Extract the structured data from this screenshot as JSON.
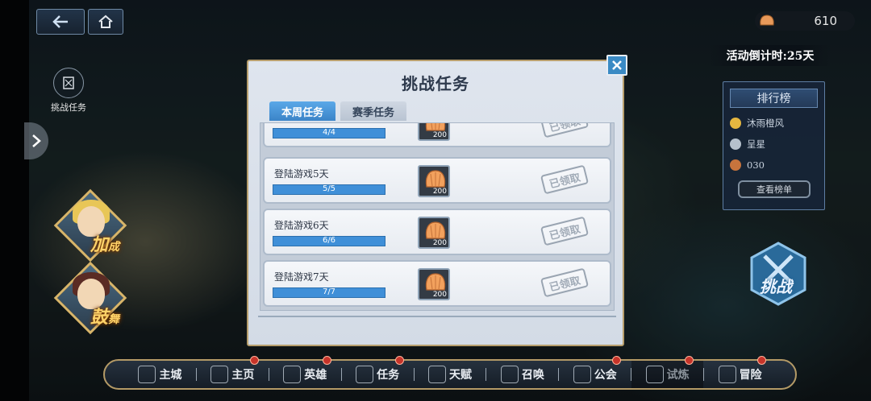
{
  "top_bar": {
    "currency_amount": "610",
    "countdown": "活动倒计时:25天"
  },
  "left": {
    "task_entry_label": "挑战任务"
  },
  "heroes": [
    {
      "tag_main": "加",
      "tag_sub": "成",
      "hair_color": "#e8c657"
    },
    {
      "tag_main": "鼓",
      "tag_sub": "舞",
      "hair_color": "#5a2b24"
    }
  ],
  "ranking": {
    "title": "排行榜",
    "rows": [
      {
        "name": "沐雨橙风",
        "medal_color": "#e4b640"
      },
      {
        "name": "呈星",
        "medal_color": "#b6c1cc"
      },
      {
        "name": "030",
        "medal_color": "#c7743d"
      }
    ],
    "button": "查看榜单"
  },
  "challenge_button": "挑战",
  "modal": {
    "title": "挑战任务",
    "tabs": [
      {
        "label": "本周任务"
      },
      {
        "label": "赛季任务"
      }
    ],
    "tasks": [
      {
        "name": "",
        "progress": "4/4",
        "progress_fraction": 1,
        "reward_qty": "200",
        "status": "已领取"
      },
      {
        "name": "登陆游戏5天",
        "progress": "5/5",
        "progress_fraction": 1,
        "reward_qty": "200",
        "status": "已领取"
      },
      {
        "name": "登陆游戏6天",
        "progress": "6/6",
        "progress_fraction": 1,
        "reward_qty": "200",
        "status": "已领取"
      },
      {
        "name": "登陆游戏7天",
        "progress": "7/7",
        "progress_fraction": 1,
        "reward_qty": "200",
        "status": "已领取"
      }
    ]
  },
  "bottom_nav": [
    {
      "label": "主城",
      "badge": false,
      "dim": false
    },
    {
      "label": "主页",
      "badge": true,
      "dim": false
    },
    {
      "label": "英雄",
      "badge": true,
      "dim": false
    },
    {
      "label": "任务",
      "badge": true,
      "dim": false
    },
    {
      "label": "天赋",
      "badge": false,
      "dim": false
    },
    {
      "label": "召唤",
      "badge": false,
      "dim": false
    },
    {
      "label": "公会",
      "badge": true,
      "dim": false
    },
    {
      "label": "试炼",
      "badge": true,
      "dim": true
    },
    {
      "label": "冒险",
      "badge": true,
      "dim": false
    }
  ],
  "colors": {
    "accent_blue": "#3f8fd8",
    "gold_border": "#b79e6c",
    "badge_red": "#c6342a"
  }
}
